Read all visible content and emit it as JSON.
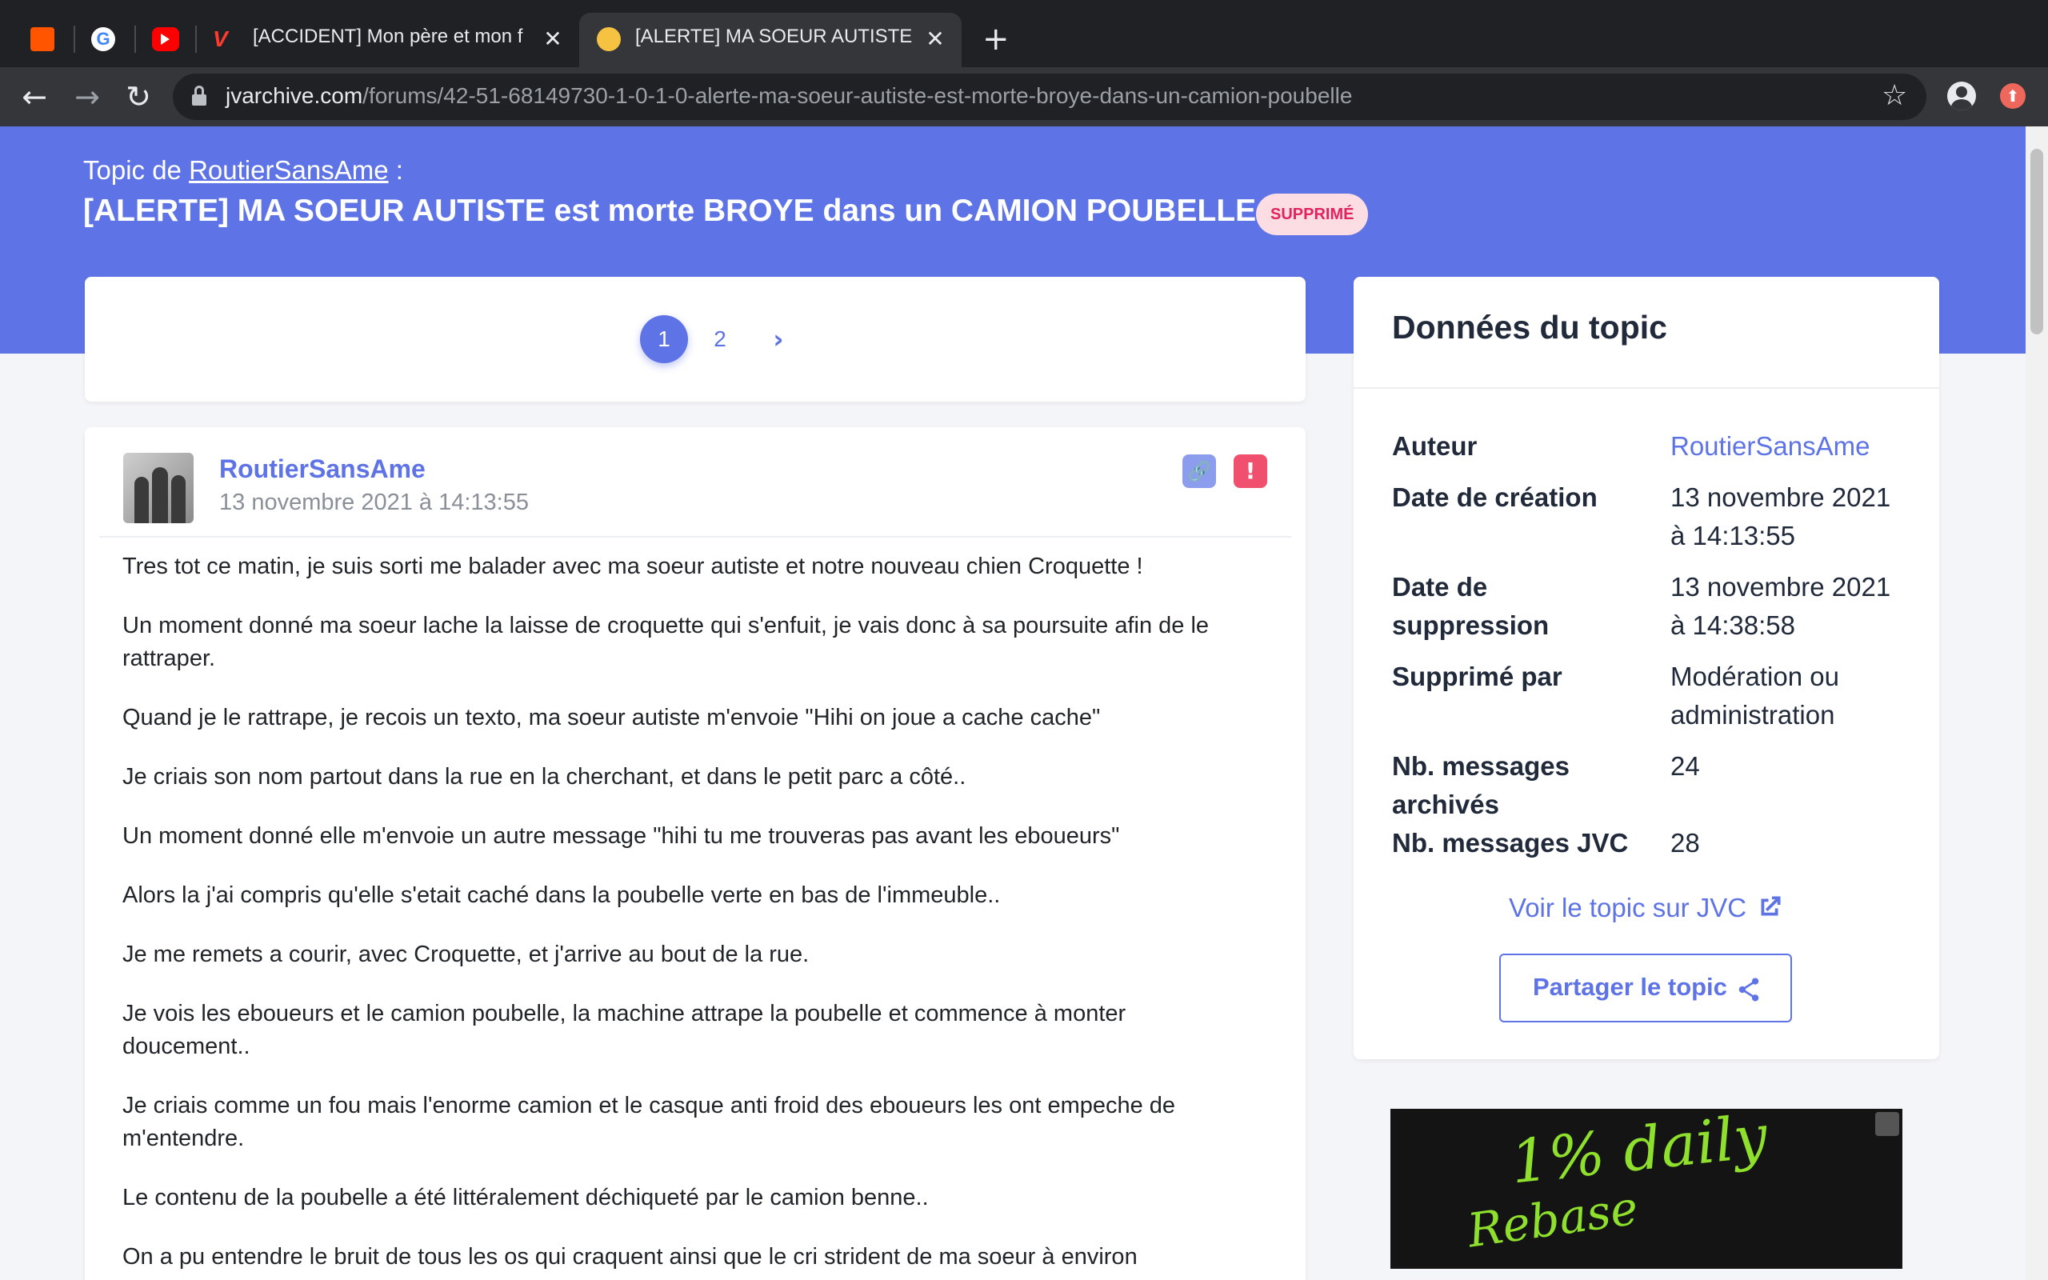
{
  "browser": {
    "tabs": [
      {
        "title": "[ACCIDENT] Mon père et mon f",
        "active": false
      },
      {
        "title": "[ALERTE] MA SOEUR AUTISTE",
        "active": true
      }
    ],
    "url_host": "jvarchive.com",
    "url_path": "/forums/42-51-68149730-1-0-1-0-alerte-ma-soeur-autiste-est-morte-broye-dans-un-camion-poubelle",
    "icons": [
      "soundcloud-icon",
      "google-icon",
      "youtube-icon",
      "jv-icon",
      "close-icon",
      "plus-icon",
      "back-icon",
      "forward-icon",
      "reload-icon",
      "lock-icon",
      "star-icon",
      "profile-icon",
      "extension-icon"
    ]
  },
  "header": {
    "topic_prefix": "Topic de ",
    "author": "RoutierSansAme",
    "topic_suffix": " :",
    "title": "[ALERTE] MA SOEUR AUTISTE est morte BROYE dans un CAMION POUBELLE",
    "badge": "SUPPRIMÉ"
  },
  "pagination": {
    "pages": [
      "1",
      "2"
    ],
    "current": "1",
    "next": "›"
  },
  "post": {
    "author": "RoutierSansAme",
    "date": "13 novembre 2021 à 14:13:55",
    "paragraphs": [
      "Tres tot ce matin, je suis sorti me balader avec ma soeur autiste et notre nouveau chien Croquette !",
      "Un moment donné ma soeur lache la laisse de croquette qui s'enfuit, je vais donc à sa poursuite afin de le rattraper.",
      "Quand je le rattrape, je recois un texto, ma soeur autiste m'envoie \"Hihi on joue a cache cache\"",
      "Je criais son nom partout dans la rue en la cherchant, et dans le petit parc a côté..",
      "Un moment donné elle m'envoie un autre message \"hihi tu me trouveras pas avant les eboueurs\"",
      "Alors la j'ai compris qu'elle s'etait caché dans la poubelle verte en bas de l'immeuble..",
      "Je me remets a courir, avec Croquette, et j'arrive au bout de la rue.",
      "Je vois les eboueurs et le camion poubelle, la machine attrape la poubelle et commence à monter doucement..",
      "Je criais comme un fou mais l'enorme camion et le casque anti froid des eboueurs les ont empeche de m'entendre.",
      "Le contenu de la poubelle a été littéralement déchiqueté par le camion benne..",
      "On a pu entendre le bruit de tous les os qui craquent ainsi que le cri strident de ma soeur à environ"
    ]
  },
  "sidebar": {
    "title": "Données du topic",
    "rows": [
      {
        "label": "Auteur",
        "value": "RoutierSansAme"
      },
      {
        "label": "Date de création",
        "value": "13 novembre 2021 à 14:13:55"
      },
      {
        "label": "Date de suppression",
        "value": "13 novembre 2021 à 14:38:58"
      },
      {
        "label": "Supprimé par",
        "value": "Modération ou administration"
      },
      {
        "label": "Nb. messages archivés",
        "value": "24"
      },
      {
        "label": "Nb. messages JVC",
        "value": "28"
      }
    ],
    "labels_split": {
      "creation": "Date de création",
      "suppression_1": "Date de",
      "suppression_2": "suppression",
      "archived_1": "Nb. messages",
      "archived_2": "archivés"
    },
    "values_split": {
      "creation_1": "13 novembre 2021",
      "creation_2": "à 14:13:55",
      "suppression_1": "13 novembre 2021",
      "suppression_2": "à 14:38:58",
      "by_1": "Modération ou",
      "by_2": "administration"
    },
    "jvc_link": "Voir le topic sur JVC",
    "share_button": "Partager le topic"
  },
  "ad": {
    "line1": "1% daily",
    "line2": "Rebase"
  },
  "colors": {
    "accent": "#5e73e5",
    "danger": "#f0506e",
    "ad_green": "#8ee02d"
  }
}
